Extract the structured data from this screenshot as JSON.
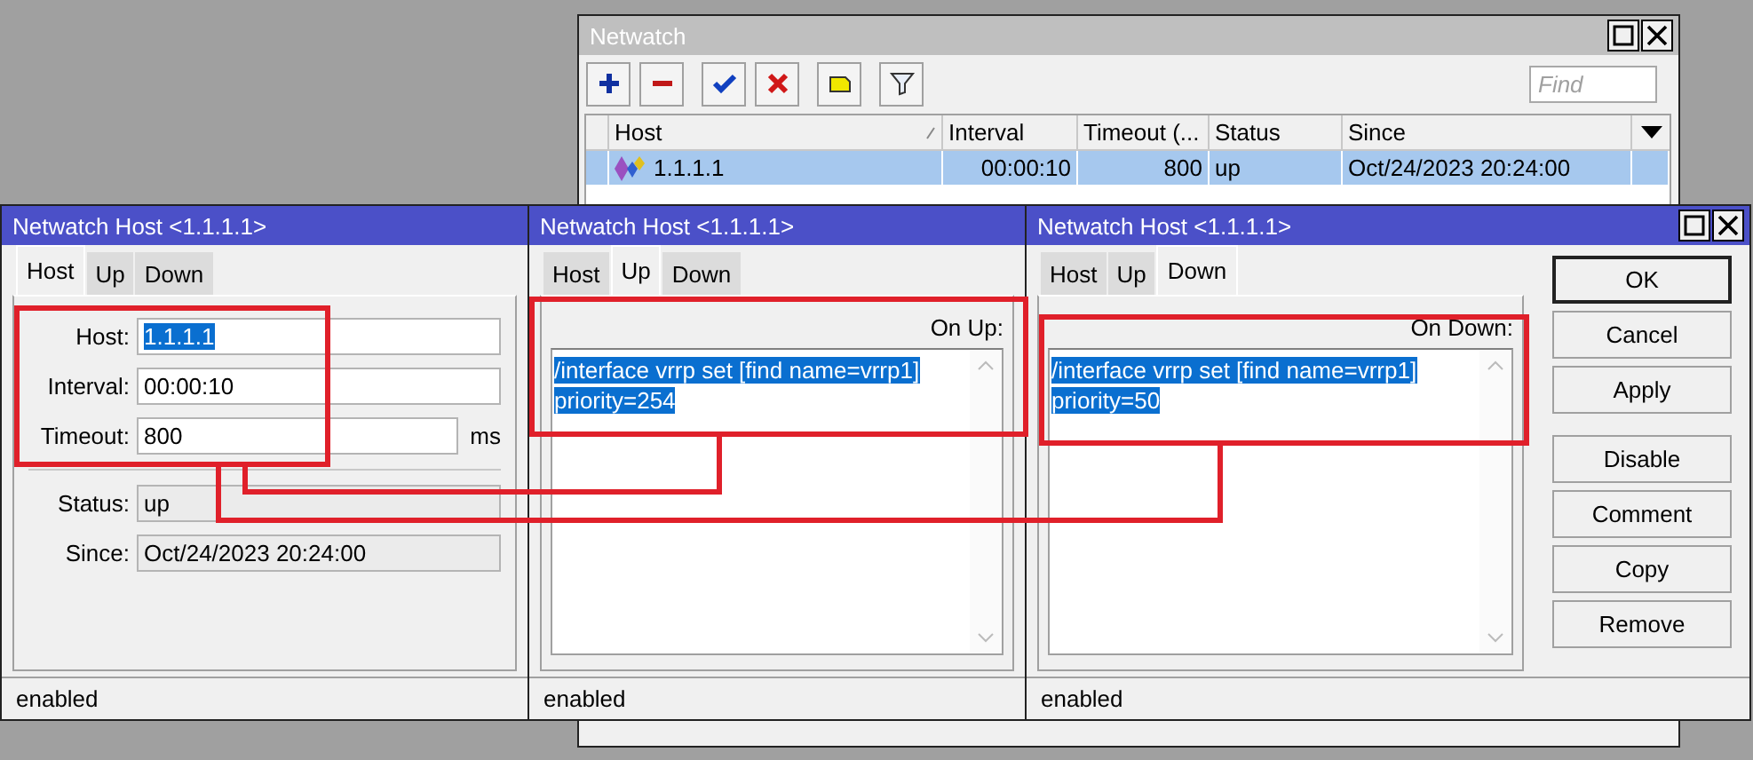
{
  "netwatch": {
    "title": "Netwatch",
    "window_buttons": true,
    "find": {
      "placeholder": "Find"
    },
    "columns": [
      "Host",
      "Interval",
      "Timeout (...",
      "Status",
      "Since"
    ],
    "rows": [
      {
        "cells": [
          "1.1.1.1",
          "00:00:10",
          "800",
          "up",
          "Oct/24/2023 20:24:00"
        ],
        "selected": true
      }
    ]
  },
  "dialogs": [
    {
      "title": "Netwatch Host <1.1.1.1>",
      "window_buttons": false,
      "kind": "host",
      "tabs": [
        {
          "label": "Host",
          "selected": true
        },
        {
          "label": "Up",
          "selected": false
        },
        {
          "label": "Down",
          "selected": false
        }
      ],
      "fields": [
        {
          "label": "Host:",
          "value": "1.1.1.1",
          "readonly": false,
          "text_selected": true
        },
        {
          "label": "Interval:",
          "value": "00:00:10",
          "readonly": false,
          "text_selected": false
        },
        {
          "label": "Timeout:",
          "value": "800",
          "unit": "ms",
          "readonly": false,
          "text_selected": false
        },
        {
          "label": "Status:",
          "value": "up",
          "readonly": true,
          "text_selected": false
        },
        {
          "label": "Since:",
          "value": "Oct/24/2023 20:24:00",
          "readonly": true,
          "text_selected": false
        }
      ],
      "status": "enabled"
    },
    {
      "title": "Netwatch Host <1.1.1.1>",
      "window_buttons": false,
      "kind": "script",
      "tabs": [
        {
          "label": "Host",
          "selected": false
        },
        {
          "label": "Up",
          "selected": true
        },
        {
          "label": "Down",
          "selected": false
        }
      ],
      "script_label": "On Up:",
      "lines": [
        "/interface vrrp set [find name=vrrp1]",
        "priority=254"
      ],
      "text_selected": true,
      "status": "enabled"
    },
    {
      "title": "Netwatch Host <1.1.1.1>",
      "window_buttons": true,
      "kind": "script",
      "tabs": [
        {
          "label": "Host",
          "selected": false
        },
        {
          "label": "Up",
          "selected": false
        },
        {
          "label": "Down",
          "selected": true
        }
      ],
      "script_label": "On Down:",
      "lines": [
        "/interface vrrp set [find name=vrrp1]",
        "priority=50"
      ],
      "text_selected": true,
      "buttons": [
        {
          "label": "OK",
          "default": true
        },
        {
          "label": "Cancel",
          "default": false
        },
        {
          "label": "Apply",
          "default": false
        },
        {
          "label": "Disable",
          "default": false
        },
        {
          "label": "Comment",
          "default": false
        },
        {
          "label": "Copy",
          "default": false
        },
        {
          "label": "Remove",
          "default": false
        }
      ],
      "status": "enabled"
    }
  ]
}
